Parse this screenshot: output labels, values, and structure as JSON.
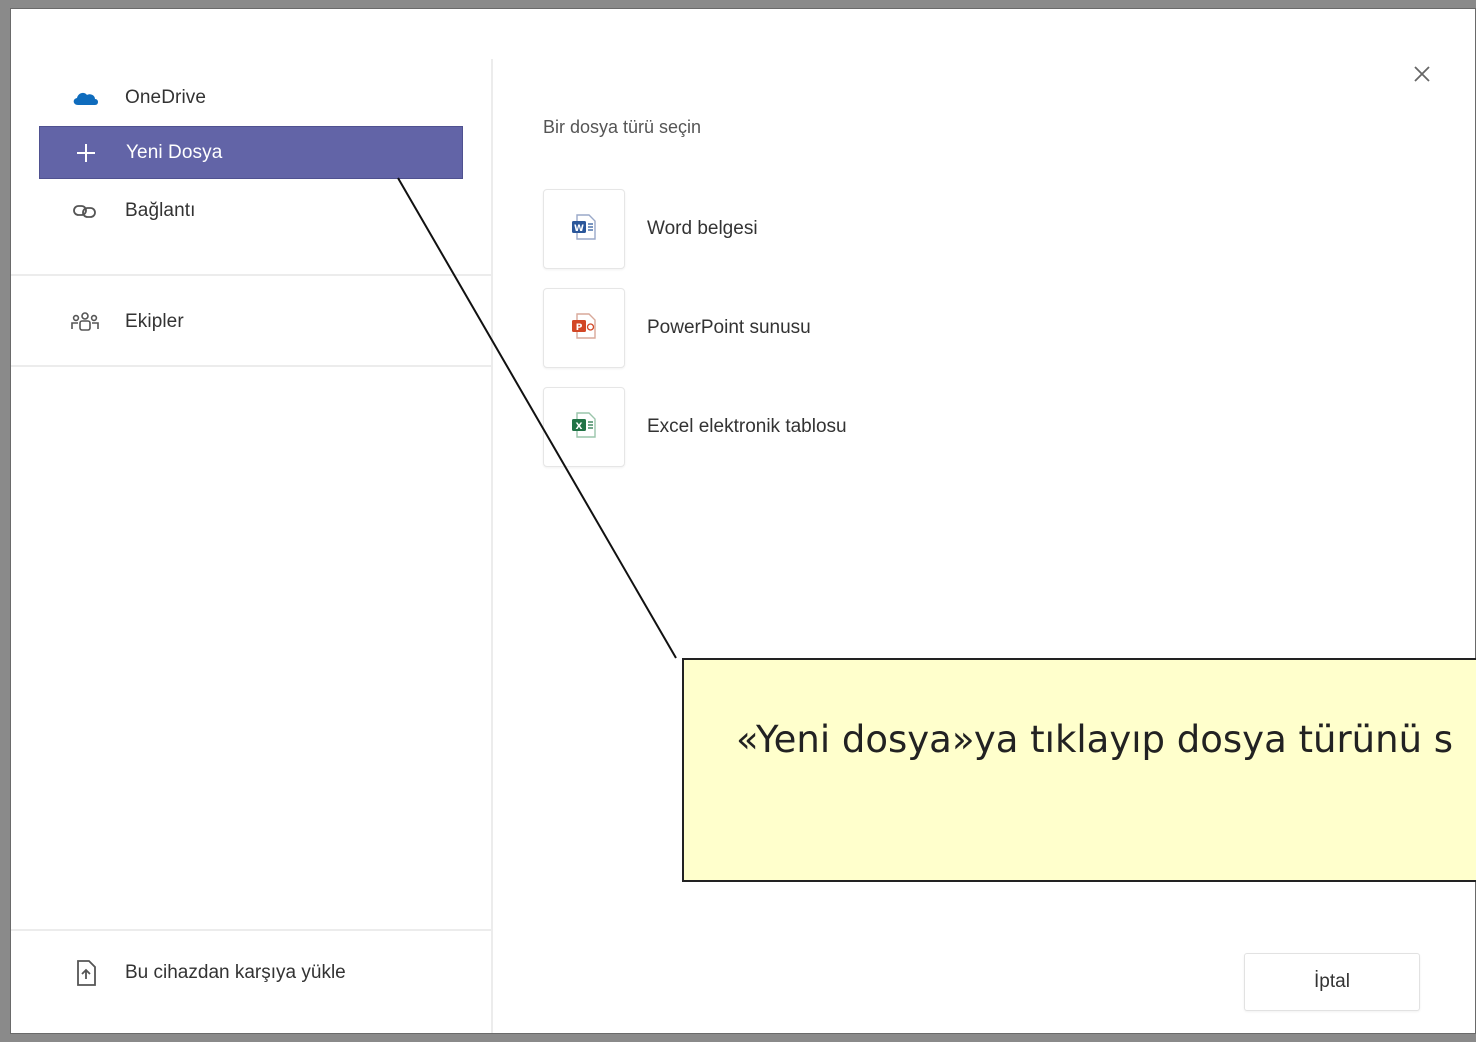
{
  "sidebar": {
    "items": [
      {
        "label": "OneDrive",
        "icon": "cloud-icon",
        "selected": false
      },
      {
        "label": "Yeni Dosya",
        "icon": "plus-icon",
        "selected": true
      },
      {
        "label": "Bağlantı",
        "icon": "link-icon",
        "selected": false
      },
      {
        "label": "Ekipler",
        "icon": "teams-icon",
        "selected": false
      }
    ],
    "upload_label": "Bu cihazdan karşıya yükle"
  },
  "main": {
    "section_title": "Bir dosya türü seçin",
    "file_types": [
      {
        "label": "Word belgesi",
        "icon": "word-icon",
        "color": "#2b579a"
      },
      {
        "label": "PowerPoint sunusu",
        "icon": "powerpoint-icon",
        "color": "#d24726"
      },
      {
        "label": "Excel elektronik tablosu",
        "icon": "excel-icon",
        "color": "#217346"
      }
    ],
    "cancel_label": "İptal"
  },
  "callout": {
    "text": "«Yeni dosya»ya tıklayıp dosya türünü s"
  },
  "colors": {
    "accent": "#6264a7",
    "onedrive": "#0f6cbd",
    "callout_bg": "#ffffcc"
  }
}
